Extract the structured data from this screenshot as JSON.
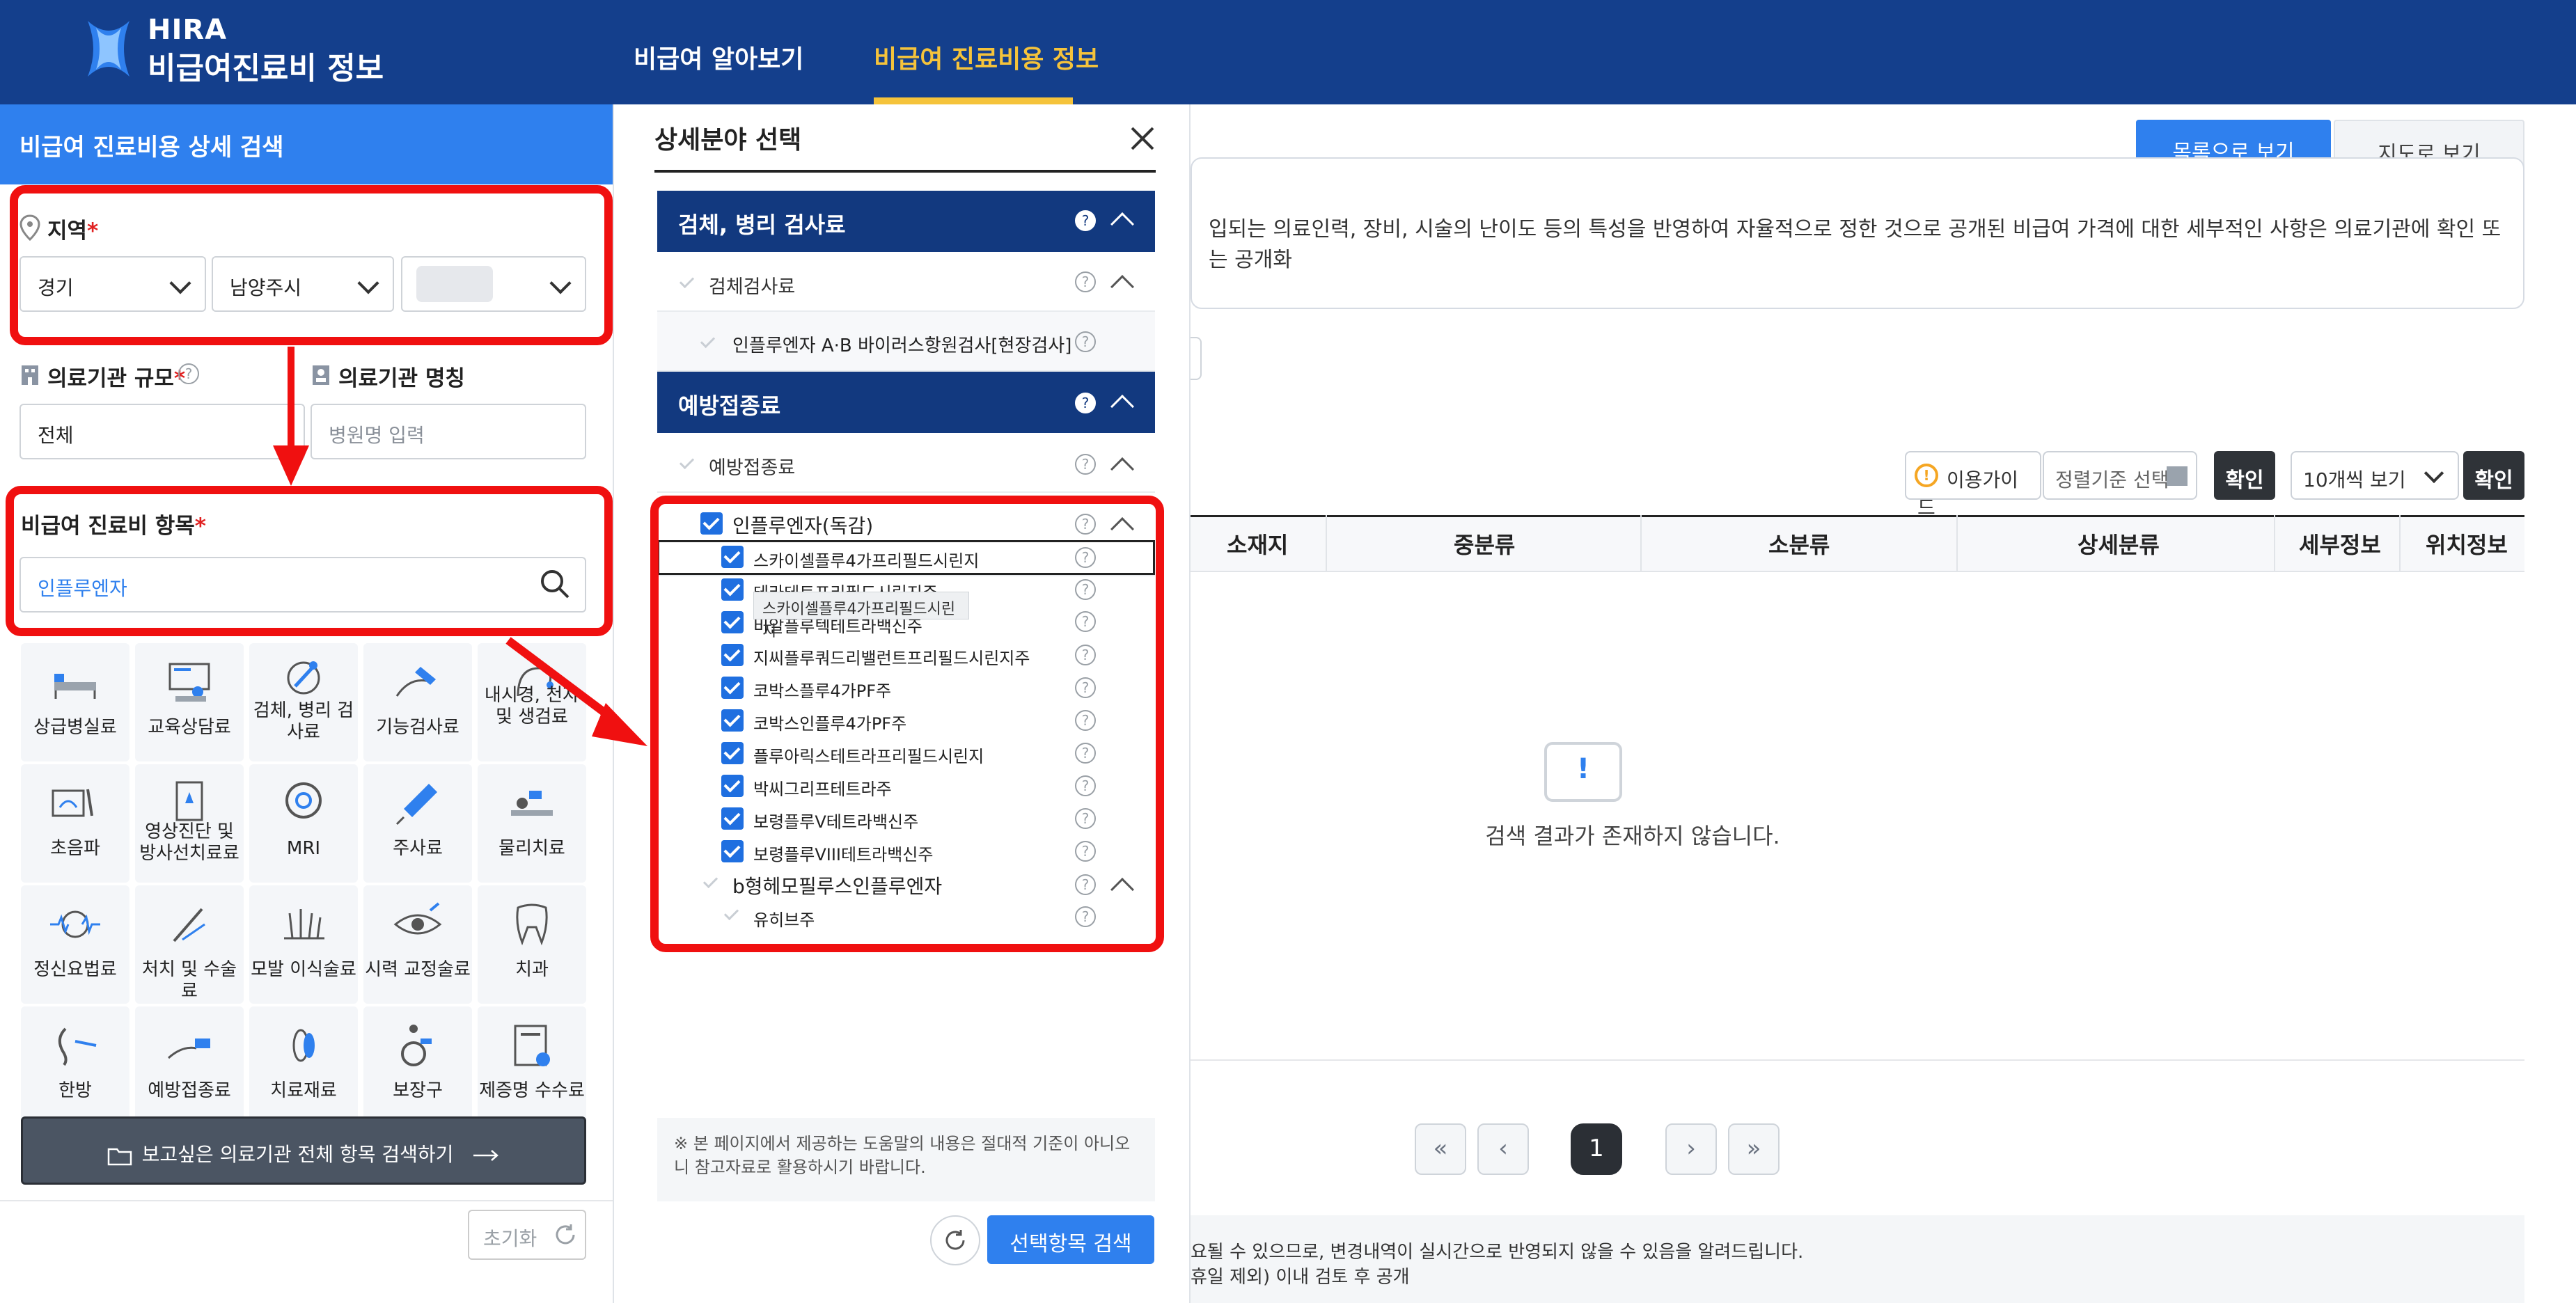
{
  "header": {
    "logo_hira": "HIRA",
    "logo_sub": "비급여진료비 정보",
    "nav": [
      "비급여 알아보기",
      "비급여 진료비용 정보"
    ]
  },
  "left_panel": {
    "title": "비급여 진료비용 상세 검색",
    "region_label": "지역",
    "region_selects": [
      "경기",
      "남양주시",
      ""
    ],
    "scale_label": "의료기관 규모",
    "scale_value": "전체",
    "name_label": "의료기관 명칭",
    "name_placeholder": "병원명 입력",
    "item_label": "비급여 진료비 항목",
    "item_value": "인플루엔자",
    "required_mark": "*",
    "categories": [
      {
        "icon": "bed-icon",
        "label": "상급병실료"
      },
      {
        "icon": "consultation-icon",
        "label": "교육상담료"
      },
      {
        "icon": "microscope-icon",
        "label": "검체, 병리 검사료"
      },
      {
        "icon": "function-test-icon",
        "label": "기능검사료"
      },
      {
        "icon": "endoscope-icon",
        "label": "내시경, 천자 및 생검료"
      },
      {
        "icon": "ultrasound-icon",
        "label": "초음파"
      },
      {
        "icon": "radiation-icon",
        "label": "영상진단 및 방사선치료료"
      },
      {
        "icon": "mri-icon",
        "label": "MRI"
      },
      {
        "icon": "syringe-icon",
        "label": "주사료"
      },
      {
        "icon": "physical-therapy-icon",
        "label": "물리치료"
      },
      {
        "icon": "brainwave-icon",
        "label": "정신요법료"
      },
      {
        "icon": "surgery-icon",
        "label": "처치 및 수술료"
      },
      {
        "icon": "hair-icon",
        "label": "모발 이식술료"
      },
      {
        "icon": "eye-icon",
        "label": "시력 교정술료"
      },
      {
        "icon": "tooth-icon",
        "label": "치과"
      },
      {
        "icon": "acupuncture-icon",
        "label": "한방"
      },
      {
        "icon": "vaccine-icon",
        "label": "예방접종료"
      },
      {
        "icon": "material-icon",
        "label": "치료재료"
      },
      {
        "icon": "wheelchair-icon",
        "label": "보장구"
      },
      {
        "icon": "certificate-icon",
        "label": "제증명 수수료"
      }
    ],
    "big_button": "보고싶은 의료기관 전체 항목 검색하기",
    "reset_button": "초기화"
  },
  "modal": {
    "title": "상세분야 선택",
    "sections": [
      {
        "title": "검체, 병리 검사료",
        "sub": "검체검사료",
        "items": [
          "인플루엔자 A·B 바이러스항원검사[현장검사]"
        ]
      },
      {
        "title": "예방접종료",
        "sub": "예방접종료"
      }
    ],
    "group_title": "인플루엔자(독감)",
    "checked_items": [
      "스카이셀플루4가프리필드시린지",
      "테라테트프리필드시린지주",
      "비알플루텍테트라백신주",
      "지씨플루쿼드리밸런트프리필드시린지주",
      "코박스플루4가PF주",
      "코박스인플루4가PF주",
      "플루아릭스테트라프리필드시린지",
      "박씨그리프테트라주",
      "보령플루V테트라백신주",
      "보령플루VIII테트라백신주"
    ],
    "tooltip": "스카이셀플루4가프리필드시린지",
    "group2_title": "b형헤모필루스인플루엔자",
    "group2_items": [
      "유히브주"
    ],
    "note": "※ 본 페이지에서 제공하는 도움말의 내용은 절대적 기준이 아니오니 참고자료로 활용하시기 바랍니다.",
    "search_button": "선택항목 검색"
  },
  "main": {
    "view_tabs": [
      "목록으로 보기",
      "지도로 보기"
    ],
    "info_text": "입되는 의료인력, 장비, 시술의 난이도 등의 특성을 반영하여 자율적으로 정한 것으로 공개된 비급여 가격에 대한 세부적인 사항은 의료기관에 확인 또는 공개화",
    "guide_button": "이용가이드",
    "sort_button": "정렬기준 선택",
    "confirm": "확인",
    "per_page": "10개씩 보기",
    "table_headers": [
      "소재지",
      "중분류",
      "소분류",
      "상세분류",
      "세부정보",
      "위치정보"
    ],
    "empty_message": "검색 결과가 존재하지 않습니다.",
    "pagination": {
      "first": "«",
      "prev": "‹",
      "current": "1",
      "next": "›",
      "last": "»"
    },
    "footer_line1": "요될 수 있으므로, 변경내역이 실시간으로 반영되지 않을 수 있음을 알려드립니다.",
    "footer_line2": "휴일 제외) 이내 검토 후 공개"
  },
  "colors": {
    "header": "#143f8c",
    "accent": "#2f80ee",
    "highlight": "#f01010",
    "nav_active": "#f5c33b"
  }
}
